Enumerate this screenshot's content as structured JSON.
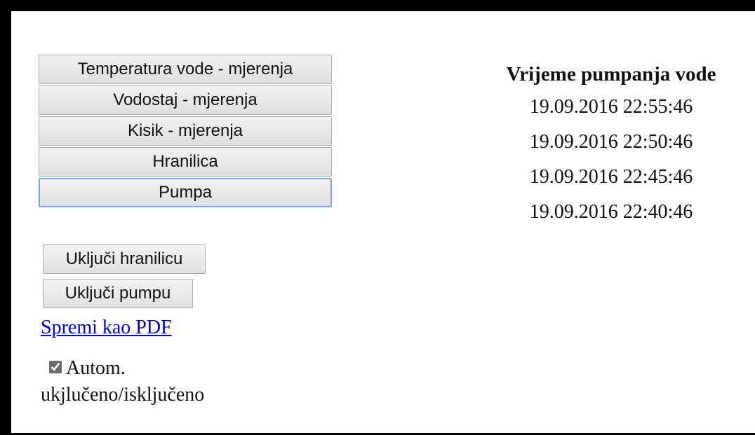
{
  "nav": {
    "items": [
      {
        "label": "Temperatura vode - mjerenja"
      },
      {
        "label": "Vodostaj - mjerenja"
      },
      {
        "label": "Kisik - mjerenja"
      },
      {
        "label": "Hranilica"
      },
      {
        "label": "Pumpa"
      }
    ],
    "active": "Pumpa"
  },
  "actions": {
    "feeder_label": "Uključi hranilicu",
    "pump_label": "Uključi pumpu"
  },
  "pdf_link": "Spremi kao PDF",
  "auto": {
    "checked": true,
    "label": "Autom. ukjlučeno/isključeno"
  },
  "pump_times": {
    "title": "Vrijeme pumpanja vode",
    "rows": [
      "19.09.2016 22:55:46",
      "19.09.2016 22:50:46",
      "19.09.2016 22:45:46",
      "19.09.2016 22:40:46"
    ]
  }
}
